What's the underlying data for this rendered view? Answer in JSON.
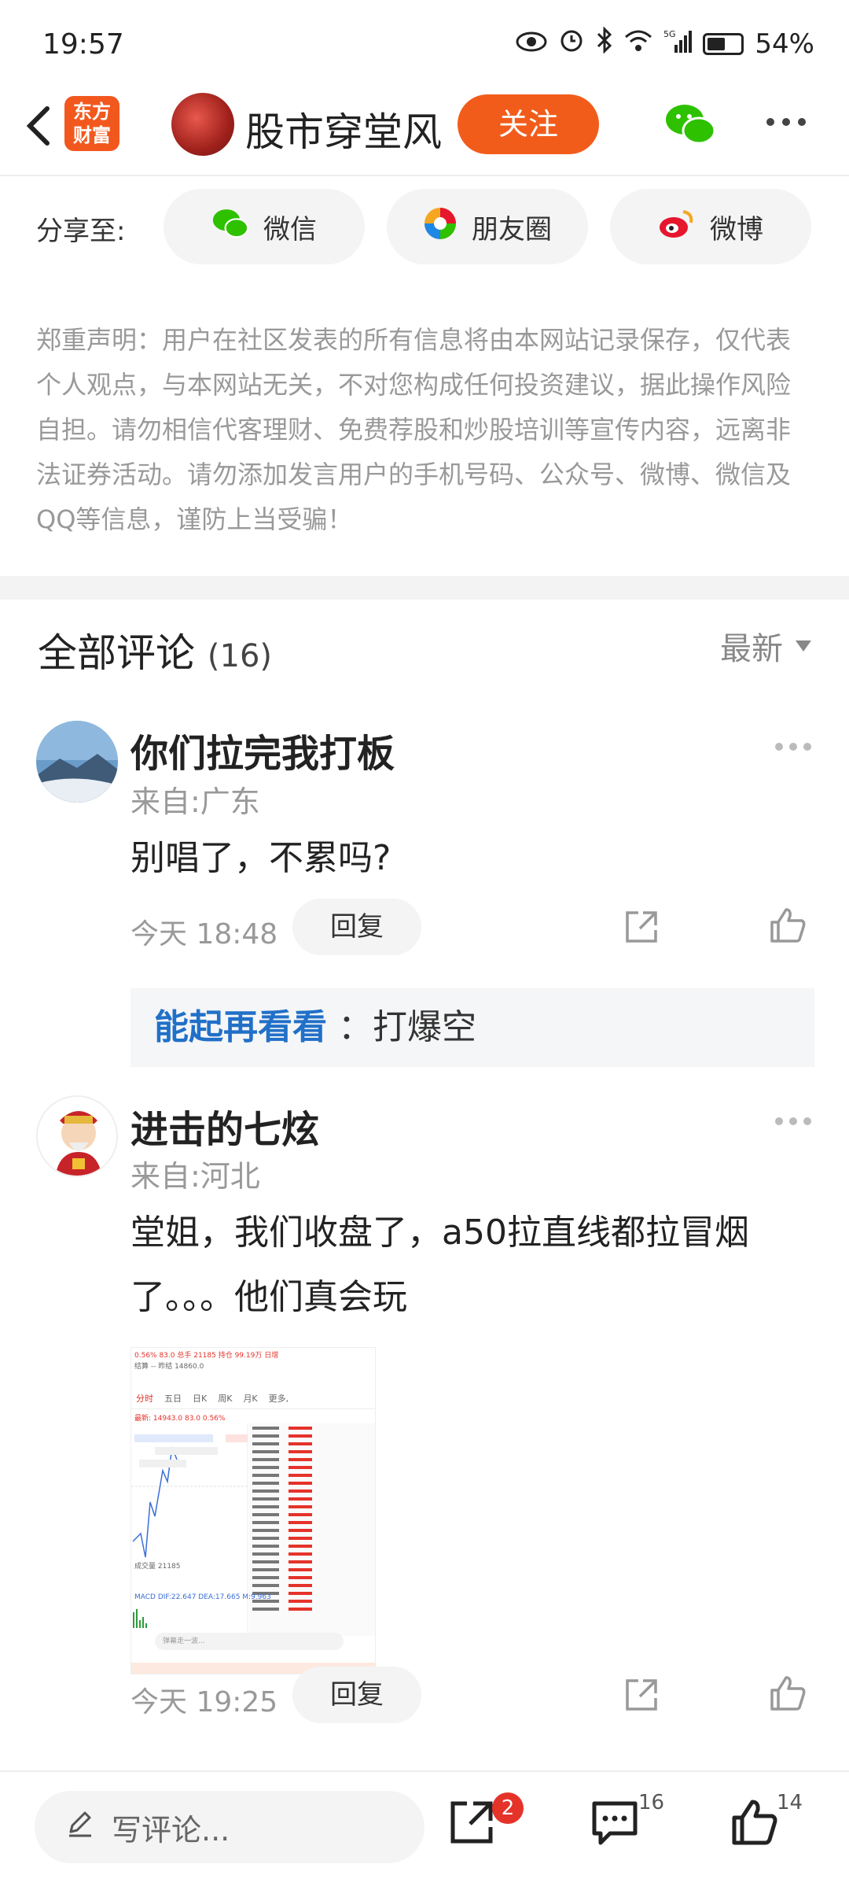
{
  "status": {
    "time": "19:57",
    "battery": "54%",
    "network": "5G"
  },
  "header": {
    "logo_line1": "东方",
    "logo_line2": "财富",
    "title": "股市穿堂风",
    "follow_label": "关注"
  },
  "share": {
    "label": "分享至:",
    "items": [
      {
        "label": "微信",
        "icon": "wechat-icon",
        "color": "#1aad19"
      },
      {
        "label": "朋友圈",
        "icon": "moments-icon",
        "color": "#f5a623"
      },
      {
        "label": "微博",
        "icon": "weibo-icon",
        "color": "#e6162d"
      }
    ]
  },
  "notice": "郑重声明：用户在社区发表的所有信息将由本网站记录保存，仅代表个人观点，与本网站无关，不对您构成任何投资建议，据此操作风险自担。请勿相信代客理财、免费荐股和炒股培训等宣传内容，远离非法证券活动。请勿添加发言用户的手机号码、公众号、微博、微信及QQ等信息，谨防上当受骗！",
  "comments_header": {
    "title": "全部评论",
    "count": "(16)",
    "sort_label": "最新"
  },
  "comments": [
    {
      "name": "你们拉完我打板",
      "location": "来自:广东",
      "text": "别唱了，不累吗?",
      "time": "今天 18:48",
      "reply_label": "回复",
      "sub_reply": {
        "name": "能起再看看",
        "text": "：打爆空"
      }
    },
    {
      "name": "进击的七炫",
      "location": "来自:河北",
      "text": "堂姐，我们收盘了，a50拉直线都拉冒烟了。。。他们真会玩",
      "time": "今天 19:25",
      "reply_label": "回复"
    }
  ],
  "thumb": {
    "line1": "0.56%   83.0   总手   21185  持仓   99.19万  日增",
    "line2": "结算        --   昨结   14860.0",
    "tabs": [
      "分时",
      "五日",
      "日K",
      "周K",
      "月K",
      "更多,"
    ],
    "price": "最新: 14943.0  83.0  0.56%",
    "indicator": "MACD  DIF:22.647  DEA:17.665  M:9.963",
    "volume": "成交量 21185",
    "input": "弹幕走一波..."
  },
  "bottom": {
    "write_placeholder": "写评论...",
    "share_badge": "2",
    "comment_count": "16",
    "like_count": "14"
  }
}
